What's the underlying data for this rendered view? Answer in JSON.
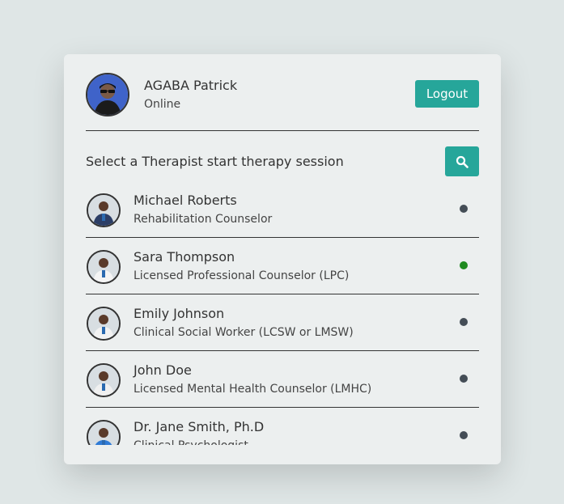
{
  "user": {
    "name": "AGABA Patrick",
    "status": "Online"
  },
  "header": {
    "logout_label": "Logout"
  },
  "search": {
    "label": "Select a Therapist start therapy session"
  },
  "colors": {
    "accent": "#26a69a",
    "online": "#1f8a1f",
    "offline": "#444d56"
  },
  "therapists": [
    {
      "name": "Michael Roberts",
      "title": "Rehabilitation Counselor",
      "online": false
    },
    {
      "name": "Sara Thompson",
      "title": "Licensed Professional Counselor (LPC)",
      "online": true
    },
    {
      "name": "Emily Johnson",
      "title": "Clinical Social Worker (LCSW or LMSW)",
      "online": false
    },
    {
      "name": "John Doe",
      "title": "Licensed Mental Health Counselor (LMHC)",
      "online": false
    },
    {
      "name": "Dr. Jane Smith, Ph.D",
      "title": "Clinical Psychologist",
      "online": false
    }
  ]
}
